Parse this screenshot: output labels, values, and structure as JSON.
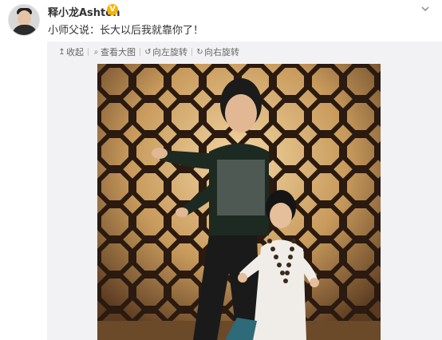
{
  "post": {
    "username": "释小龙Ashton",
    "verified_mark": "V",
    "text": "小师父说：长大以后我就靠你了！"
  },
  "toolbar": {
    "items": [
      {
        "icon": "arrow-up-icon",
        "glyph": "↥",
        "label": "收起"
      },
      {
        "icon": "search-icon",
        "glyph": "⌕",
        "label": "查看大图"
      },
      {
        "icon": "rotate-left-icon",
        "glyph": "↺",
        "label": "向左旋转"
      },
      {
        "icon": "rotate-right-icon",
        "glyph": "↻",
        "label": "向右旋转"
      }
    ]
  },
  "photo": {
    "icon": "photo-image"
  },
  "colors": {
    "verified": "#f8b400",
    "background": "#f2f2f5",
    "text": "#333333"
  }
}
